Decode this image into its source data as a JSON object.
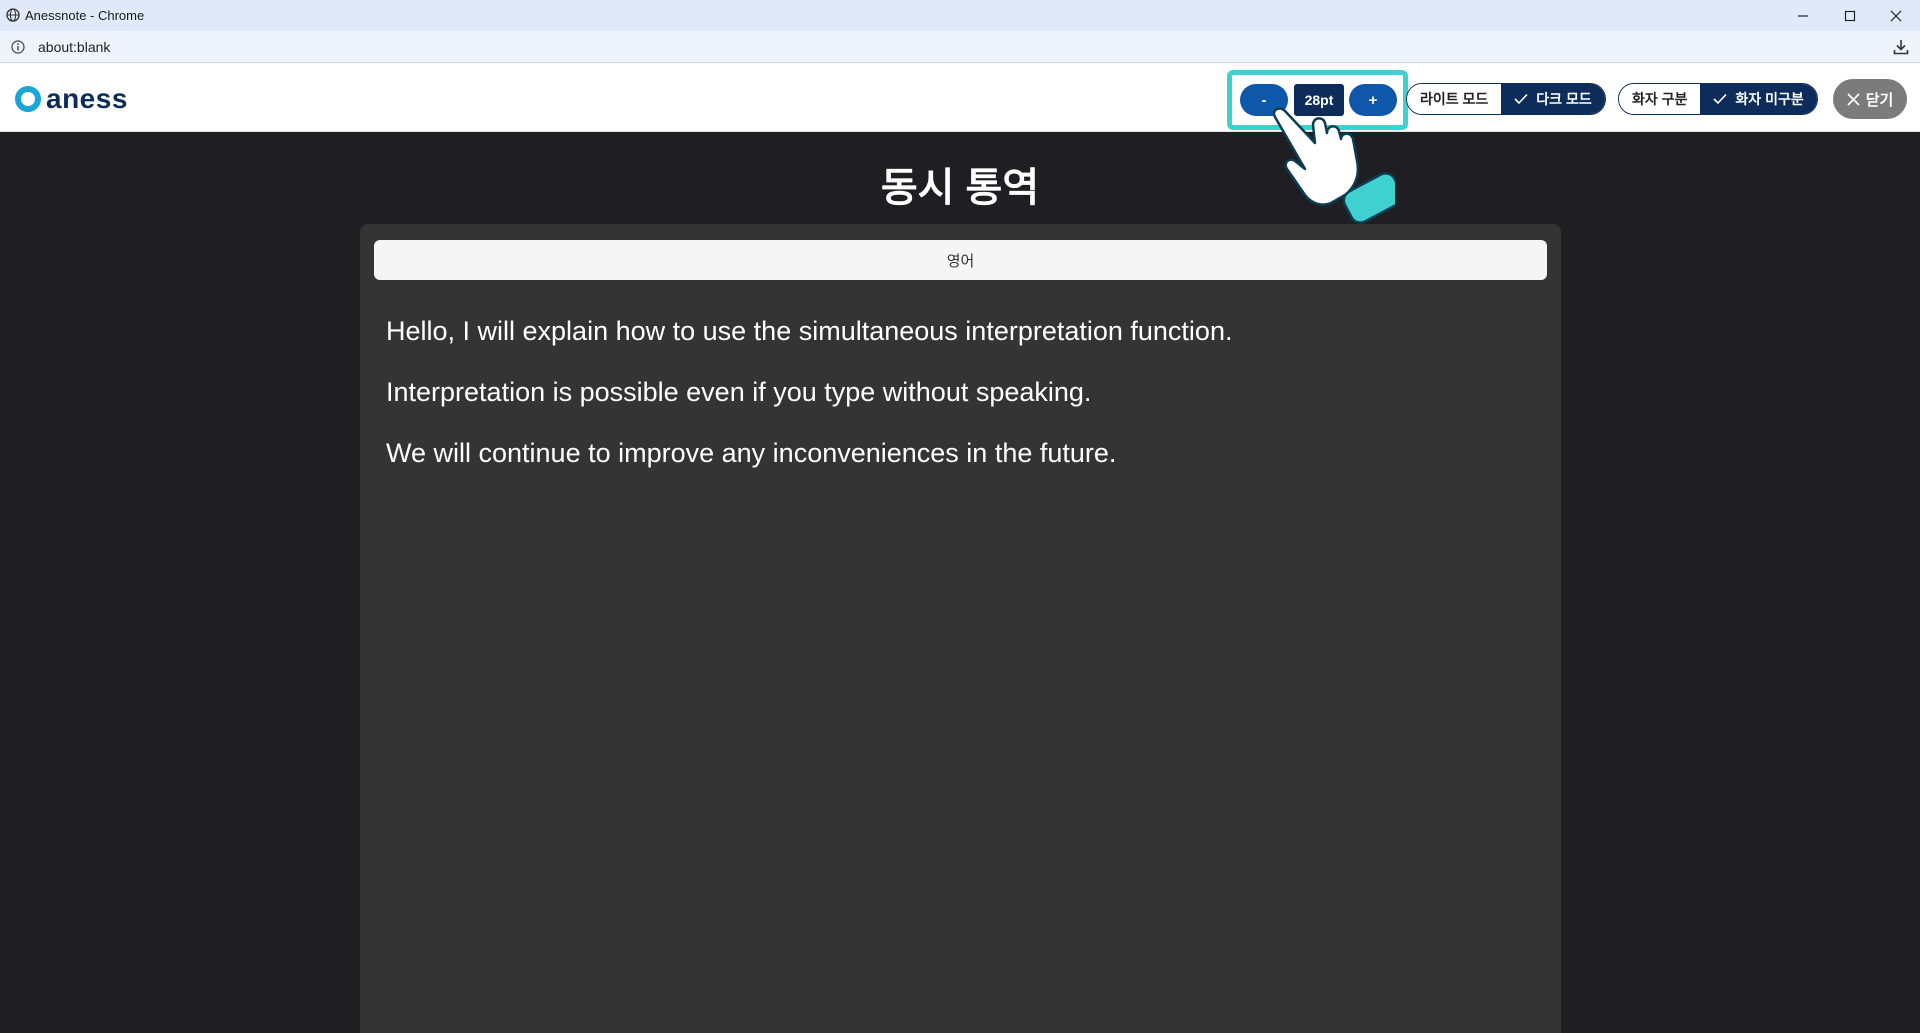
{
  "window": {
    "title": "Anessnote - Chrome",
    "url": "about:blank"
  },
  "header": {
    "logo_text": "aness",
    "font": {
      "minus_label": "-",
      "size_label": "28pt",
      "plus_label": "+"
    },
    "theme_toggle": {
      "light_label": "라이트 모드",
      "dark_label": "다크 모드",
      "selected": "dark"
    },
    "speaker_toggle": {
      "separate_label": "화자 구분",
      "merged_label": "화자 미구분",
      "selected": "merged"
    },
    "close_label": "닫기"
  },
  "main": {
    "title": "동시 통역",
    "language": "영어",
    "lines": [
      "Hello, I will explain how to use the simultaneous interpretation function.",
      "Interpretation is possible even if you type without speaking.",
      "We will continue to improve any inconveniences in the future."
    ]
  },
  "colors": {
    "accent": "#0f57a8",
    "navy": "#0e2c5a",
    "highlight": "#3fd0d0",
    "background": "#1f1f23",
    "panel": "#343434"
  }
}
